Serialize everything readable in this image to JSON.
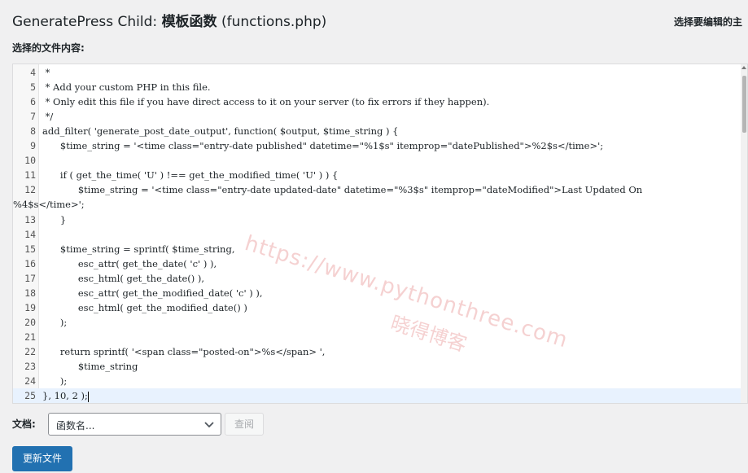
{
  "header": {
    "title_prefix": "GeneratePress Child: ",
    "title_bold": "模板函数",
    "title_suffix": " (functions.php)",
    "select_theme_label": "选择要编辑的主"
  },
  "editor": {
    "content_label": "选择的文件内容:",
    "lines": [
      {
        "num": "4",
        "code": " *"
      },
      {
        "num": "5",
        "code": " * Add your custom PHP in this file."
      },
      {
        "num": "6",
        "code": " * Only edit this file if you have direct access to it on your server (to fix errors if they happen)."
      },
      {
        "num": "7",
        "code": " */"
      },
      {
        "num": "8",
        "code": "add_filter( 'generate_post_date_output', function( $output, $time_string ) {"
      },
      {
        "num": "9",
        "code": "      $time_string = '<time class=\"entry-date published\" datetime=\"%1$s\" itemprop=\"datePublished\">%2$s</time>';"
      },
      {
        "num": "10",
        "code": ""
      },
      {
        "num": "11",
        "code": "      if ( get_the_time( 'U' ) !== get_the_modified_time( 'U' ) ) {"
      },
      {
        "num": "12",
        "code": "            $time_string = '<time class=\"entry-date updated-date\" datetime=\"%3$s\" itemprop=\"dateModified\">Last Updated On"
      },
      {
        "num": "",
        "code": "%4$s</time>';"
      },
      {
        "num": "13",
        "code": "      }"
      },
      {
        "num": "14",
        "code": ""
      },
      {
        "num": "15",
        "code": "      $time_string = sprintf( $time_string,"
      },
      {
        "num": "16",
        "code": "            esc_attr( get_the_date( 'c' ) ),"
      },
      {
        "num": "17",
        "code": "            esc_html( get_the_date() ),"
      },
      {
        "num": "18",
        "code": "            esc_attr( get_the_modified_date( 'c' ) ),"
      },
      {
        "num": "19",
        "code": "            esc_html( get_the_modified_date() )"
      },
      {
        "num": "20",
        "code": "      );"
      },
      {
        "num": "21",
        "code": ""
      },
      {
        "num": "22",
        "code": "      return sprintf( '<span class=\"posted-on\">%s</span> ',"
      },
      {
        "num": "23",
        "code": "            $time_string"
      },
      {
        "num": "24",
        "code": "      );"
      },
      {
        "num": "25",
        "code": "}, 10, 2 );"
      }
    ],
    "watermark_url": "https://www.pythonthree.com",
    "watermark_cn": "晓得博客"
  },
  "footer": {
    "doc_label": "文档:",
    "doc_select_value": "函数名...",
    "lookup_button": "查阅",
    "update_button": "更新文件"
  },
  "colors": {
    "primary_button": "#2271b1",
    "active_line": "#e8f2fe",
    "background": "#f0f0f1"
  }
}
